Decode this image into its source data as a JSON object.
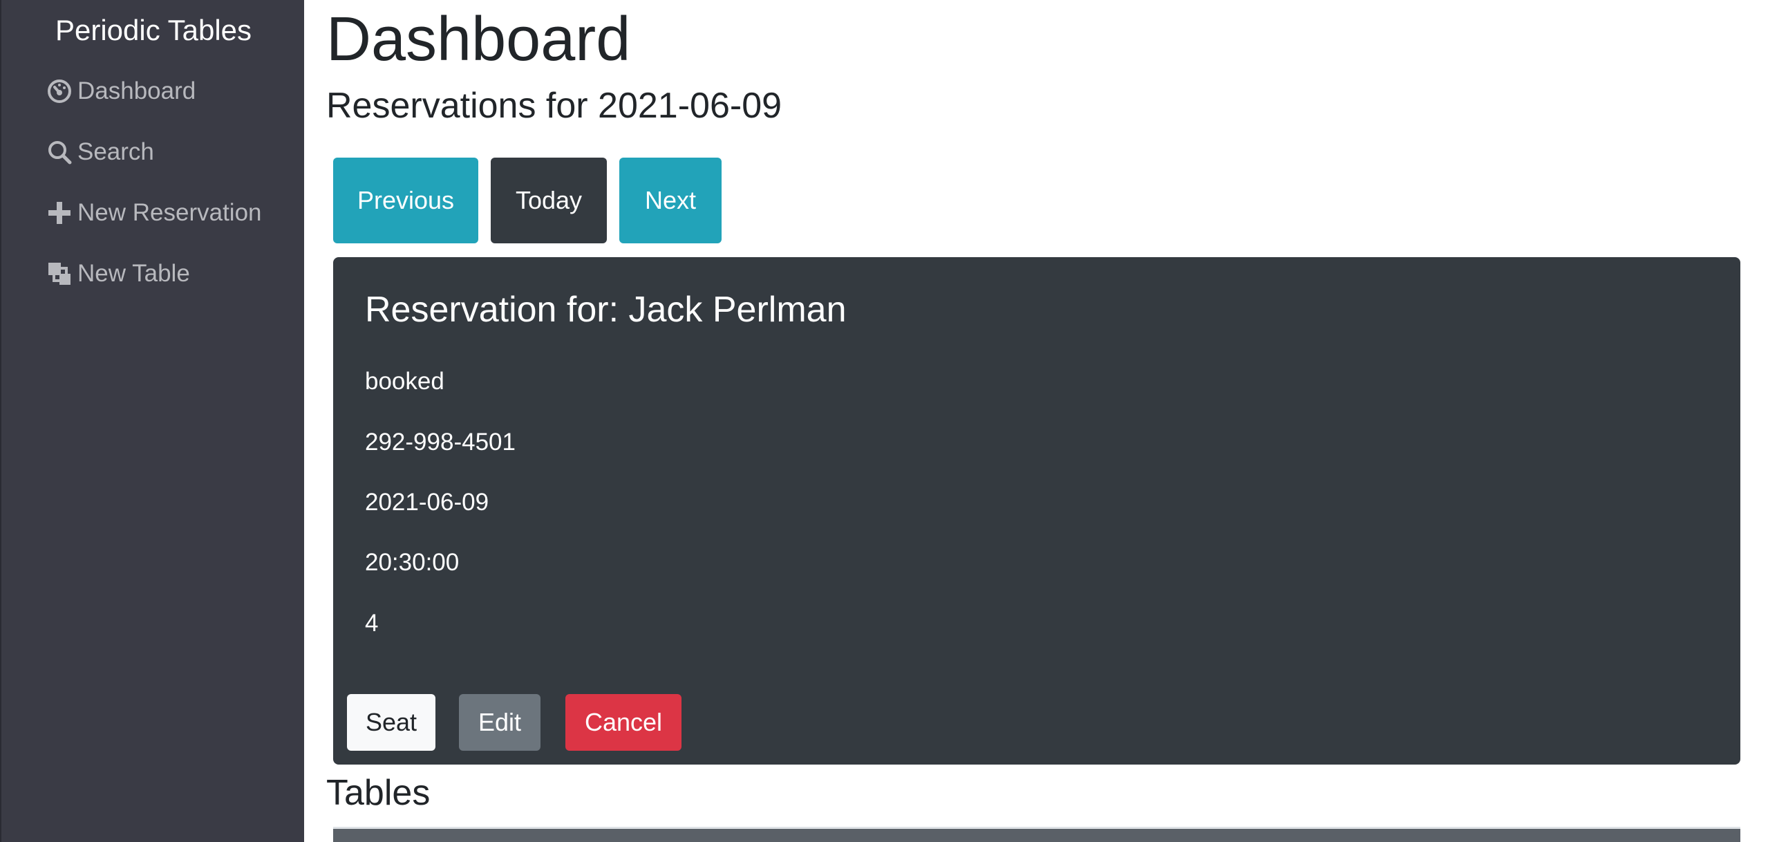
{
  "sidebar": {
    "brand": "Periodic Tables",
    "items": [
      {
        "label": "Dashboard",
        "icon": "dashboard-icon"
      },
      {
        "label": "Search",
        "icon": "search-icon"
      },
      {
        "label": "New Reservation",
        "icon": "plus-icon"
      },
      {
        "label": "New Table",
        "icon": "layers-icon"
      }
    ]
  },
  "main": {
    "title": "Dashboard",
    "subtitle": "Reservations for 2021-06-09",
    "nav_buttons": {
      "previous": "Previous",
      "today": "Today",
      "next": "Next"
    },
    "reservation": {
      "title": "Reservation for: Jack Perlman",
      "status": "booked",
      "phone": "292-998-4501",
      "date": "2021-06-09",
      "time": "20:30:00",
      "people": "4",
      "actions": {
        "seat": "Seat",
        "edit": "Edit",
        "cancel": "Cancel"
      }
    },
    "tables_heading": "Tables"
  },
  "colors": {
    "sidebar_bg": "#3a3b45",
    "info": "#22a3b9",
    "dark": "#343a40",
    "secondary": "#6c757d",
    "danger": "#dc3545",
    "light": "#f8f9fa"
  }
}
